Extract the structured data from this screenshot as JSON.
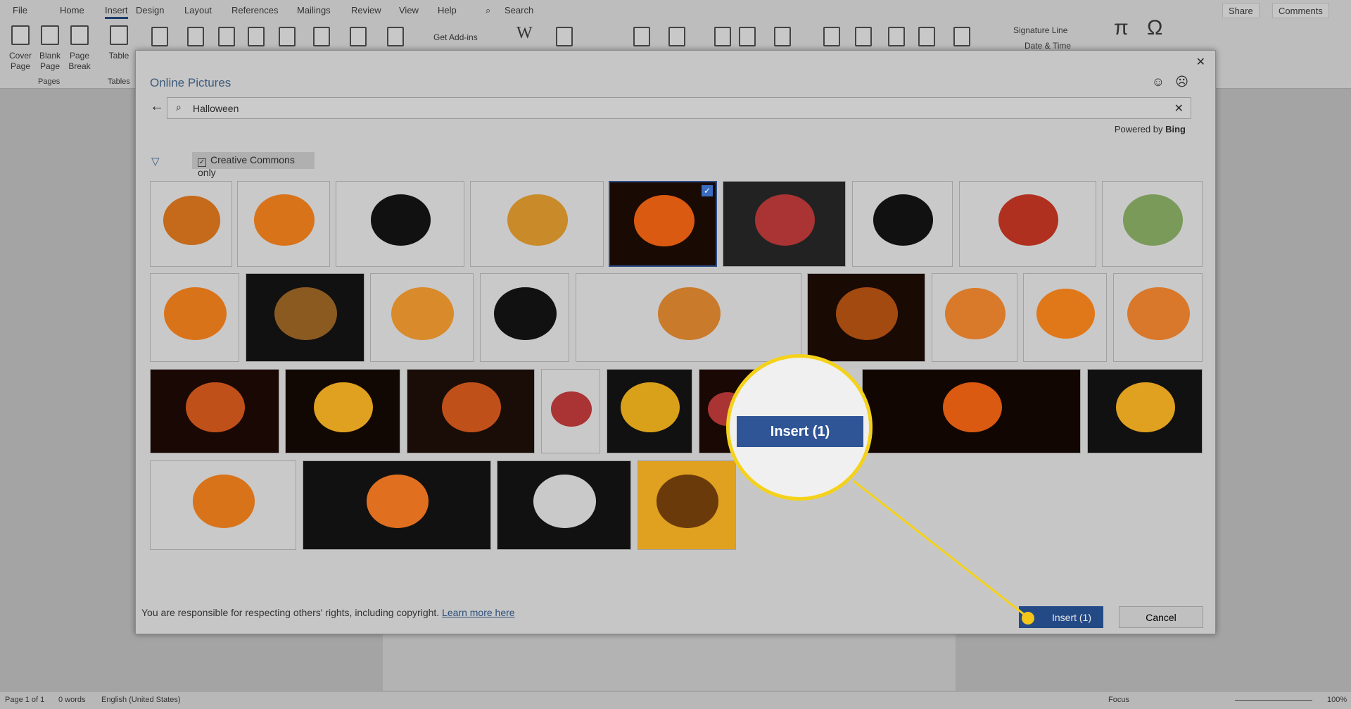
{
  "menu": {
    "tabs": [
      "File",
      "Home",
      "Insert",
      "Design",
      "Layout",
      "References",
      "Mailings",
      "Review",
      "View",
      "Help"
    ],
    "active": "Insert",
    "search": "Search",
    "share": "Share",
    "comments": "Comments"
  },
  "ribbon": {
    "cover_page": "Cover Page",
    "blank_page": "Blank Page",
    "page_break": "Page Break",
    "table": "Table",
    "group_pages": "Pages",
    "group_tables": "Tables",
    "get_addins": "Get Add-ins",
    "wikipedia": "W",
    "signature_line": "Signature Line",
    "date_time": "Date & Time",
    "equation": "π",
    "symbol": "Ω"
  },
  "dialog": {
    "title": "Online Pictures",
    "search_value": "Halloween",
    "powered_by": "Powered by",
    "bing": "Bing",
    "creative_commons": "Creative Commons only",
    "creative_commons_checked": true,
    "footer_text": "You are responsible for respecting others' rights, including copyright.",
    "learn_more": "Learn more here",
    "insert": "Insert (1)",
    "cancel": "Cancel",
    "selected_count": 1
  },
  "callout": {
    "label": "Insert (1)",
    "accent": "#f5d21a"
  },
  "thumbnails": [
    [
      "#c9c9c9",
      "#c46a1a"
    ],
    [
      "#c9c9c9",
      "#d9731a"
    ],
    [
      "#c9c9c9",
      "#111"
    ],
    [
      "#c9c9c9",
      "#c98a2a"
    ],
    [
      "#1a0a04",
      "#d95a10"
    ],
    [
      "#222",
      "#a33"
    ],
    [
      "#c9c9c9",
      "#111"
    ],
    [
      "#c9c9c9",
      "#b03020"
    ],
    [
      "#c9c9c9",
      "#7a9a5a"
    ],
    [
      "#c9c9c9",
      "#d9731a"
    ],
    [
      "#111",
      "#8a5a20"
    ],
    [
      "#c9c9c9",
      "#d98a2a"
    ],
    [
      "#c9c9c9",
      "#111"
    ],
    [
      "#c9c9c9",
      "#c97a2a"
    ],
    [
      "#1a0a04",
      "#a34a10"
    ],
    [
      "#c9c9c9",
      "#d97a2a"
    ],
    [
      "#c9c9c9",
      "#e0781a"
    ],
    [
      "#c9c9c9",
      "#d9782a"
    ],
    [
      "#1a0804",
      "#c0501a"
    ],
    [
      "#120803",
      "#e0a020"
    ],
    [
      "#1a0c06",
      "#c0501a"
    ],
    [
      "#c9c9c9",
      "#a33"
    ],
    [
      "#111",
      "#d9a01a"
    ],
    [
      "#1a0804",
      "#a33"
    ],
    [
      "#120603",
      "#d95a10"
    ],
    [
      "#111",
      "#e0a020"
    ],
    [
      "#c9c9c9",
      "#d9731a"
    ],
    [
      "#111",
      "#e07020"
    ],
    [
      "#111",
      "#c9c9c9"
    ],
    [
      "#e0a020",
      "#6a3a0a"
    ]
  ],
  "status": {
    "page": "Page 1 of 1",
    "words": "0 words",
    "language": "English (United States)",
    "focus": "Focus",
    "zoom": "100%"
  }
}
